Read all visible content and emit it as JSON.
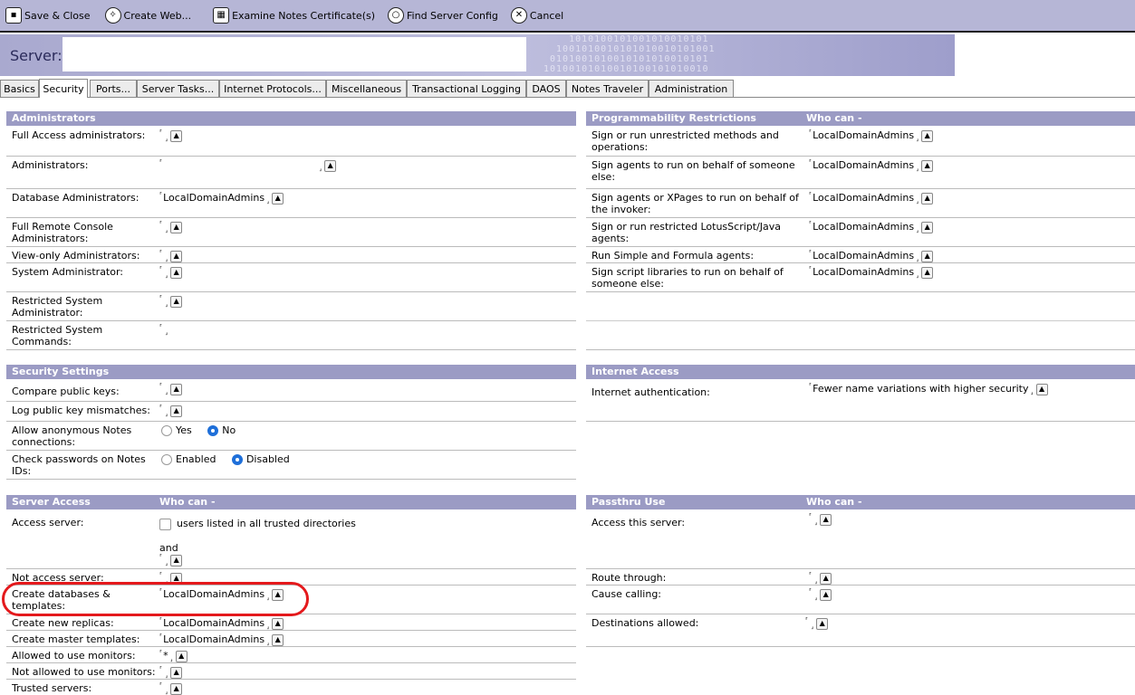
{
  "toolbar": [
    {
      "label": "Save & Close",
      "icon": "save-icon"
    },
    {
      "label": "Create Web...",
      "icon": "create-web-icon"
    },
    {
      "label": "Examine Notes Certificate(s)",
      "icon": "certificate-icon"
    },
    {
      "label": "Find Server Config",
      "icon": "search-icon"
    },
    {
      "label": "Cancel",
      "icon": "cancel-icon"
    }
  ],
  "banner": {
    "server_label": "Server:",
    "server_value": ""
  },
  "tabs": [
    {
      "label": "Basics"
    },
    {
      "label": "Security"
    },
    {
      "label": "Ports..."
    },
    {
      "label": "Server Tasks..."
    },
    {
      "label": "Internet Protocols..."
    },
    {
      "label": "Miscellaneous"
    },
    {
      "label": "Transactional Logging"
    },
    {
      "label": "DAOS"
    },
    {
      "label": "Notes Traveler"
    },
    {
      "label": "Administration"
    }
  ],
  "active_tab": "Security",
  "administrators": {
    "title": "Administrators",
    "rows": [
      {
        "label": "Full Access administrators:",
        "value": ""
      },
      {
        "label": "Administrators:",
        "value": ""
      },
      {
        "label": "Database Administrators:",
        "value": "LocalDomainAdmins"
      },
      {
        "label": "Full Remote Console Administrators:",
        "value": ""
      },
      {
        "label": "View-only Administrators:",
        "value": ""
      },
      {
        "label": "System Administrator:",
        "value": ""
      },
      {
        "label": "Restricted System Administrator:",
        "value": ""
      },
      {
        "label": "Restricted System Commands:",
        "value": ""
      }
    ]
  },
  "programmability": {
    "title": "Programmability  Restrictions",
    "who_can": "Who can -",
    "rows": [
      {
        "label": "Sign or run unrestricted methods and operations:",
        "value": "LocalDomainAdmins"
      },
      {
        "label": "Sign agents to run on behalf of someone else:",
        "value": "LocalDomainAdmins"
      },
      {
        "label": "Sign agents or XPages  to run on behalf of the invoker:",
        "value": "LocalDomainAdmins"
      },
      {
        "label": "Sign or run restricted LotusScript/Java agents:",
        "value": "LocalDomainAdmins"
      },
      {
        "label": "Run Simple and Formula agents:",
        "value": "LocalDomainAdmins"
      },
      {
        "label": "Sign script libraries to run on behalf of someone else:",
        "value": "LocalDomainAdmins"
      }
    ]
  },
  "security_settings": {
    "title": "Security Settings",
    "rows": [
      {
        "label": "Compare public keys:"
      },
      {
        "label": "Log public key mismatches:"
      },
      {
        "label": "Allow anonymous Notes connections:",
        "options": [
          "Yes",
          "No"
        ],
        "selected": "No"
      },
      {
        "label": "Check passwords on Notes IDs:",
        "options": [
          "Enabled",
          "Disabled"
        ],
        "selected": "Disabled"
      }
    ]
  },
  "internet_access": {
    "title": "Internet Access",
    "rows": [
      {
        "label": "Internet authentication:",
        "value": "Fewer name variations with higher security"
      }
    ]
  },
  "server_access": {
    "title": "Server Access",
    "who_can": "Who can -",
    "access_server_label": "Access server:",
    "checkbox_label": "users listed in all trusted directories",
    "and_label": "and",
    "rows": [
      {
        "label": "Not access server:",
        "value": ""
      },
      {
        "label": "Create databases & templates:",
        "value": "LocalDomainAdmins"
      },
      {
        "label": "Create new replicas:",
        "value": "LocalDomainAdmins"
      },
      {
        "label": "Create master templates:",
        "value": "LocalDomainAdmins"
      },
      {
        "label": "Allowed to use monitors:",
        "value": "*"
      },
      {
        "label": "Not allowed to use monitors:",
        "value": ""
      },
      {
        "label": "Trusted servers:",
        "value": ""
      }
    ]
  },
  "passthru": {
    "title": "Passthru Use",
    "who_can": "Who can -",
    "rows": [
      {
        "label": "Access this server:",
        "value": ""
      },
      {
        "label": "Route through:",
        "value": ""
      },
      {
        "label": "Cause calling:",
        "value": ""
      },
      {
        "label": "Destinations allowed:",
        "value": ""
      }
    ]
  },
  "colors": {
    "toolbar": "#b6b6d6",
    "section_header": "#9b9bc4",
    "highlight": "#e4191c"
  }
}
